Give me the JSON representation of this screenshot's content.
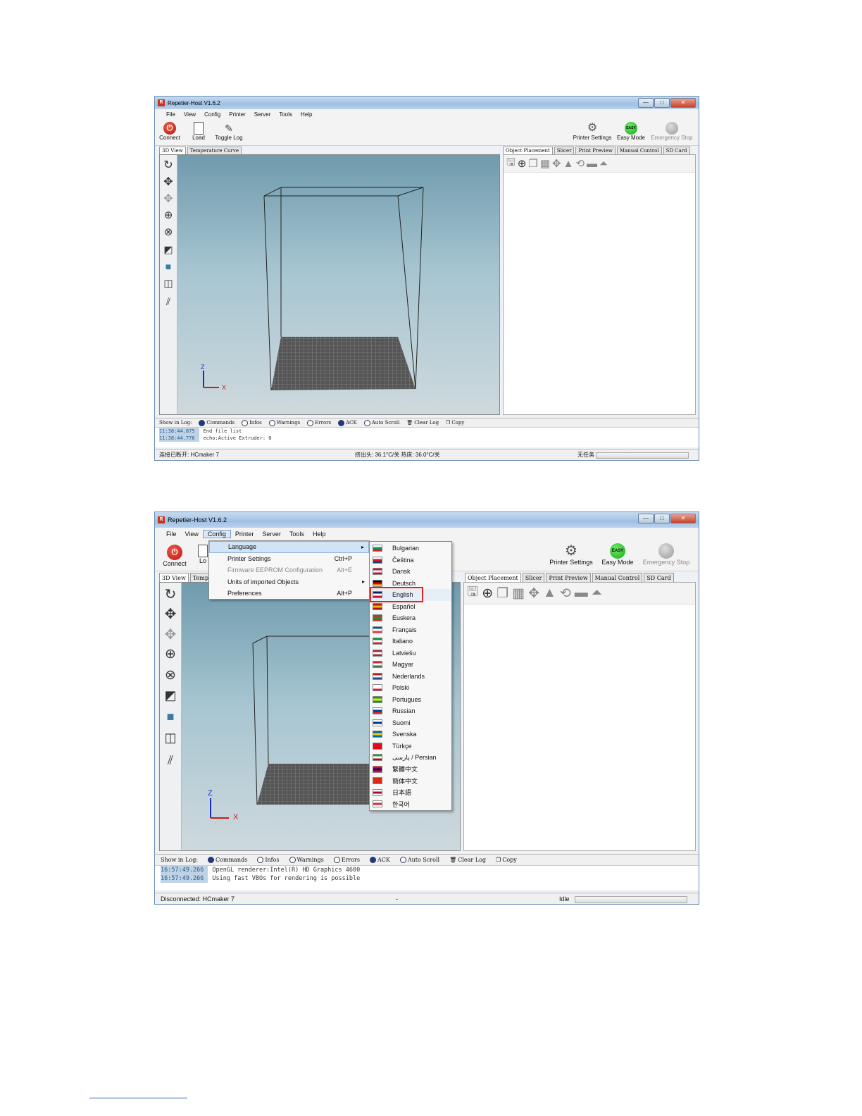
{
  "shot1": {
    "title": "Repetier-Host V1.6.2",
    "menu": [
      "File",
      "View",
      "Config",
      "Printer",
      "Server",
      "Tools",
      "Help"
    ],
    "toolbar": {
      "connect": "Connect",
      "load": "Load",
      "toggle_log": "Toggle Log",
      "printer_settings": "Printer Settings",
      "easy_mode": "Easy Mode",
      "easy_badge": "EASY",
      "emergency_stop": "Emergency Stop"
    },
    "left_tabs": [
      "3D View",
      "Temperature Curve"
    ],
    "right_tabs": [
      "Object Placement",
      "Slicer",
      "Print Preview",
      "Manual Control",
      "SD Card"
    ],
    "axis": {
      "z": "Z",
      "x": "X"
    },
    "logbar": {
      "show_in_log": "Show in Log:",
      "items": [
        {
          "label": "Commands",
          "on": true
        },
        {
          "label": "Infos",
          "on": false
        },
        {
          "label": "Warnings",
          "on": false
        },
        {
          "label": "Errors",
          "on": false
        },
        {
          "label": "ACK",
          "on": true
        },
        {
          "label": "Auto Scroll",
          "on": false
        }
      ],
      "clear_log": "Clear Log",
      "copy": "Copy"
    },
    "log": [
      {
        "time": "11:38:44.875",
        "msg": "End file list"
      },
      {
        "time": "11:38:44.776",
        "msg": "echo:Active Extruder: 0"
      }
    ],
    "status": {
      "left": "连接已断开: HCmaker 7",
      "center": "挤出头: 36.1°C/关 热床: 36.0°C/关",
      "right": "无任务"
    }
  },
  "shot2": {
    "title": "Repetier-Host V1.6.2",
    "menu": [
      "File",
      "View",
      "Config",
      "Printer",
      "Server",
      "Tools",
      "Help"
    ],
    "toolbar": {
      "connect": "Connect",
      "load": "Lo",
      "printer_settings": "Printer Settings",
      "easy_mode": "Easy Mode",
      "easy_badge": "EASY",
      "emergency_stop": "Emergency Stop"
    },
    "left_tabs": [
      "3D View",
      "Tempe"
    ],
    "right_tabs": [
      "Object Placement",
      "Slicer",
      "Print Preview",
      "Manual Control",
      "SD Card"
    ],
    "config_menu": [
      {
        "label": "Language",
        "shortcut": "",
        "submenu": true,
        "highlight": true,
        "disabled": false
      },
      {
        "label": "Printer Settings",
        "shortcut": "Ctrl+P",
        "submenu": false,
        "highlight": false,
        "disabled": false
      },
      {
        "label": "Firmware EEPROM Configuration",
        "shortcut": "Alt+E",
        "submenu": false,
        "highlight": false,
        "disabled": true
      },
      {
        "label": "Units of imported Objects",
        "shortcut": "",
        "submenu": true,
        "highlight": false,
        "disabled": false
      },
      {
        "label": "Preferences",
        "shortcut": "Alt+P",
        "submenu": false,
        "highlight": false,
        "disabled": false
      }
    ],
    "languages": [
      {
        "label": "Bulgarian",
        "flag": [
          "#ffffff",
          "#00966e",
          "#d62612"
        ]
      },
      {
        "label": "Čeština",
        "flag": [
          "#ffffff",
          "#d7141a",
          "#11457e"
        ]
      },
      {
        "label": "Dansk",
        "flag": [
          "#c8102e",
          "#ffffff",
          "#c8102e"
        ]
      },
      {
        "label": "Deutsch",
        "flag": [
          "#000000",
          "#dd0000",
          "#ffce00"
        ]
      },
      {
        "label": "English",
        "flag": [
          "#012169",
          "#ffffff",
          "#c8102e"
        ]
      },
      {
        "label": "Español",
        "flag": [
          "#aa151b",
          "#f1bf00",
          "#aa151b"
        ]
      },
      {
        "label": "Euskera",
        "flag": [
          "#d52b1e",
          "#009b48",
          "#d52b1e"
        ]
      },
      {
        "label": "Français",
        "flag": [
          "#0055a4",
          "#ffffff",
          "#ef4135"
        ]
      },
      {
        "label": "Italiano",
        "flag": [
          "#009246",
          "#ffffff",
          "#ce2b37"
        ]
      },
      {
        "label": "Latviešu",
        "flag": [
          "#9e3039",
          "#ffffff",
          "#9e3039"
        ]
      },
      {
        "label": "Magyar",
        "flag": [
          "#ce2939",
          "#ffffff",
          "#477050"
        ]
      },
      {
        "label": "Nederlands",
        "flag": [
          "#ae1c28",
          "#ffffff",
          "#21468b"
        ]
      },
      {
        "label": "Polski",
        "flag": [
          "#ffffff",
          "#ffffff",
          "#dc143c"
        ]
      },
      {
        "label": "Portugues",
        "flag": [
          "#009c3b",
          "#ffdf00",
          "#009c3b"
        ]
      },
      {
        "label": "Russian",
        "flag": [
          "#ffffff",
          "#0039a6",
          "#d52b1e"
        ]
      },
      {
        "label": "Suomi",
        "flag": [
          "#ffffff",
          "#003580",
          "#ffffff"
        ]
      },
      {
        "label": "Svenska",
        "flag": [
          "#006aa7",
          "#fecc00",
          "#006aa7"
        ]
      },
      {
        "label": "Türkçe",
        "flag": [
          "#e30a17",
          "#e30a17",
          "#e30a17"
        ]
      },
      {
        "label": "پارسی / Persian",
        "flag": [
          "#239f40",
          "#ffffff",
          "#da0000"
        ]
      },
      {
        "label": "繁體中文",
        "flag": [
          "#fe0000",
          "#000095",
          "#fe0000"
        ]
      },
      {
        "label": "簡体中文",
        "flag": [
          "#de2910",
          "#de2910",
          "#de2910"
        ]
      },
      {
        "label": "日本語",
        "flag": [
          "#ffffff",
          "#bc002d",
          "#ffffff"
        ]
      },
      {
        "label": "한국어",
        "flag": [
          "#ffffff",
          "#cd2e3a",
          "#ffffff"
        ]
      }
    ],
    "selected_language": "English",
    "axis": {
      "z": "Z",
      "x": "X"
    },
    "logbar": {
      "show_in_log": "Show in Log:",
      "items": [
        {
          "label": "Commands",
          "on": true
        },
        {
          "label": "Infos",
          "on": false
        },
        {
          "label": "Warnings",
          "on": false
        },
        {
          "label": "Errors",
          "on": false
        },
        {
          "label": "ACK",
          "on": true
        },
        {
          "label": "Auto Scroll",
          "on": false
        }
      ],
      "clear_log": "Clear Log",
      "copy": "Copy"
    },
    "log": [
      {
        "time": "16:57:49.266",
        "msg": "OpenGL renderer:Intel(R) HD Graphics 4600"
      },
      {
        "time": "16:57:49.266",
        "msg": "Using fast VBOs for rendering is possible"
      }
    ],
    "status": {
      "left": "Disconnected: HCmaker 7",
      "center": "-",
      "right": "Idle"
    }
  }
}
